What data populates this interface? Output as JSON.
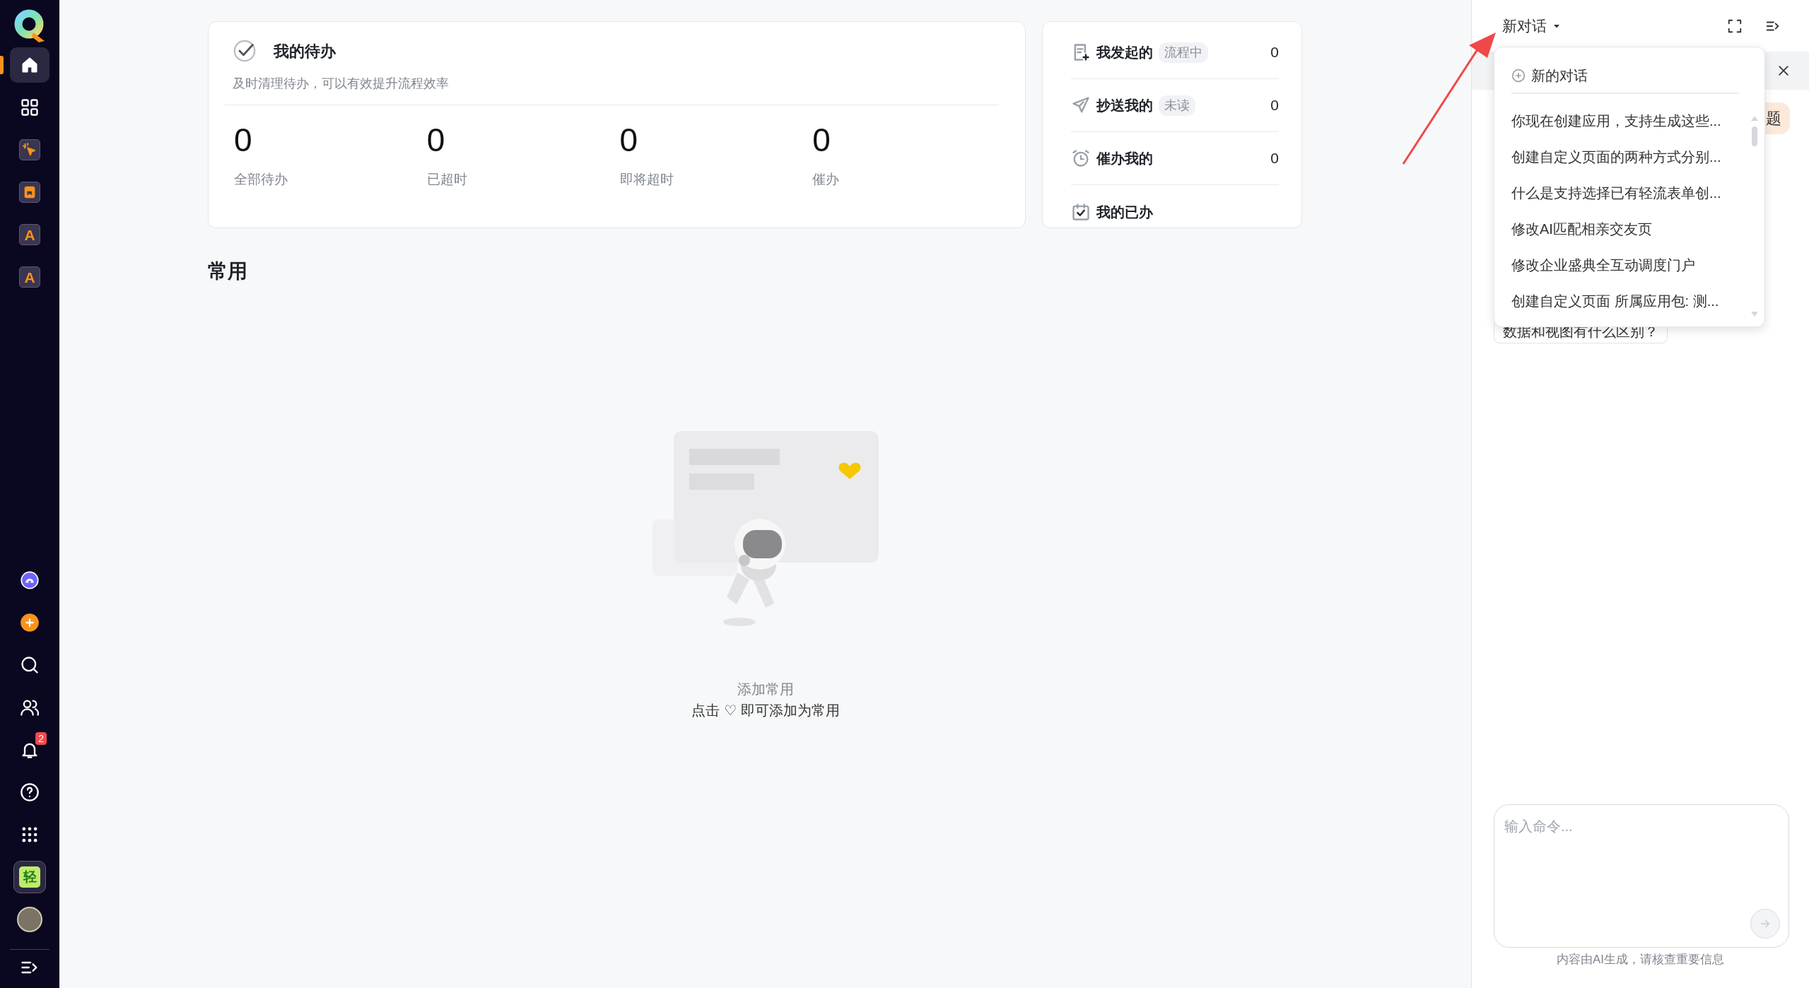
{
  "sidebar": {
    "top_items": [
      {
        "kind": "home",
        "selected": true
      },
      {
        "kind": "grid",
        "selected": false
      },
      {
        "kind": "cursor",
        "selected": false
      },
      {
        "kind": "tablet",
        "selected": false
      },
      {
        "kind": "letter",
        "label": "A",
        "selected": false
      },
      {
        "kind": "letter",
        "label": "A",
        "selected": false
      }
    ],
    "bottom_items": [
      {
        "kind": "assistant"
      },
      {
        "kind": "add"
      },
      {
        "kind": "search"
      },
      {
        "kind": "contacts"
      },
      {
        "kind": "bell",
        "badge": "2"
      },
      {
        "kind": "help"
      },
      {
        "kind": "apps"
      },
      {
        "kind": "app",
        "label": "轻"
      },
      {
        "kind": "avatar"
      },
      {
        "kind": "collapse"
      }
    ]
  },
  "todo_card": {
    "title": "我的待办",
    "subtitle": "及时清理待办，可以有效提升流程效率",
    "stats": [
      {
        "value": "0",
        "label": "全部待办"
      },
      {
        "value": "0",
        "label": "已超时"
      },
      {
        "value": "0",
        "label": "即将超时"
      },
      {
        "value": "0",
        "label": "催办"
      }
    ]
  },
  "flow_card": {
    "items": [
      {
        "kind": "started",
        "label": "我发起的",
        "tag": "流程中",
        "count": "0"
      },
      {
        "kind": "cc",
        "label": "抄送我的",
        "tag": "未读",
        "count": "0"
      },
      {
        "kind": "urge",
        "label": "催办我的",
        "count": "0"
      },
      {
        "kind": "done",
        "label": "我的已办"
      }
    ]
  },
  "favorites": {
    "title": "常用",
    "empty_title": "添加常用",
    "empty_hint": "点击 ♡ 即可添加为常用"
  },
  "assistant": {
    "title": "新对话",
    "chip": "题",
    "bubble": "数据和视图有什么区别？",
    "menu": {
      "new_label": "新的对话",
      "items": [
        "你现在创建应用，支持生成这些...",
        "创建自定义页面的两种方式分别...",
        "什么是支持选择已有轻流表单创...",
        "修改AI匹配相亲交友页",
        "修改企业盛典全互动调度门户",
        "创建自定义页面 所属应用包: 测..."
      ]
    },
    "input": {
      "placeholder": "输入命令..."
    },
    "disclaimer": "内容由AI生成，请核查重要信息"
  }
}
